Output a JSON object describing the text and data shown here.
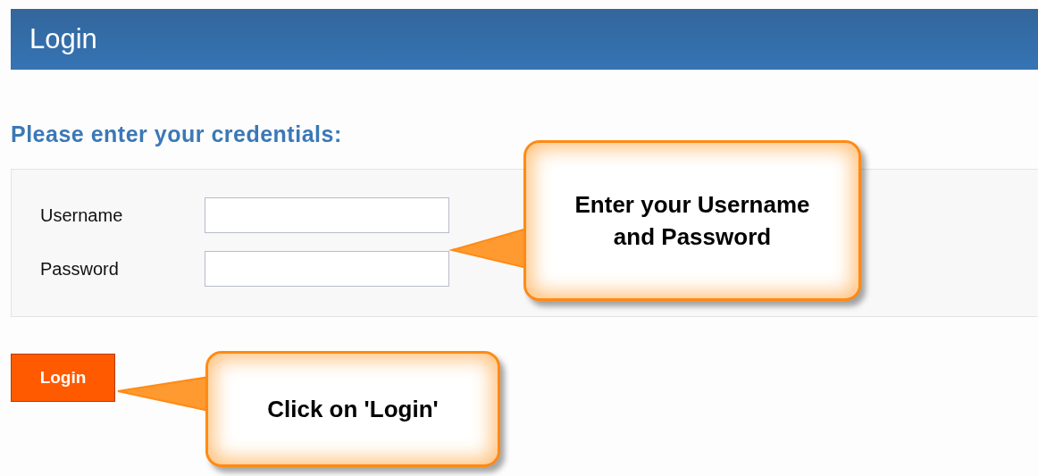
{
  "header": {
    "title": "Login"
  },
  "heading": "Please enter your credentials:",
  "fields": [
    {
      "label": "Username"
    },
    {
      "label": "Password"
    }
  ],
  "button": {
    "label": "Login"
  },
  "callouts": [
    {
      "text": "Enter your Username and Password"
    },
    {
      "text": "Click on 'Login'"
    }
  ]
}
